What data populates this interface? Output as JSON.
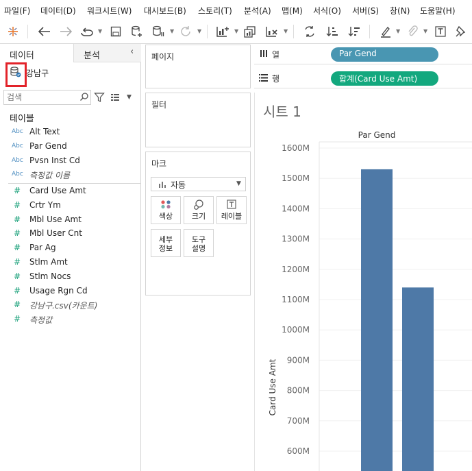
{
  "menu": [
    "파일(F)",
    "데이터(D)",
    "워크시트(W)",
    "대시보드(B)",
    "스토리(T)",
    "분석(A)",
    "맵(M)",
    "서식(O)",
    "서버(S)",
    "창(N)",
    "도움말(H)"
  ],
  "datapane": {
    "tab_data": "데이터",
    "tab_analysis": "분석",
    "datasource": "강남구",
    "search_placeholder": "검색",
    "tables_header": "테이블",
    "dimensions": [
      {
        "type": "Abc",
        "name": "Alt Text"
      },
      {
        "type": "Abc",
        "name": "Par Gend"
      },
      {
        "type": "Abc",
        "name": "Pvsn Inst Cd"
      },
      {
        "type": "Abc",
        "name": "측정값 이름"
      }
    ],
    "measures": [
      {
        "type": "#",
        "name": "Card Use Amt"
      },
      {
        "type": "#",
        "name": "Crtr Ym"
      },
      {
        "type": "#",
        "name": "Mbl Use Amt"
      },
      {
        "type": "#",
        "name": "Mbl User Cnt"
      },
      {
        "type": "#",
        "name": "Par Ag"
      },
      {
        "type": "#",
        "name": "Stlm Amt"
      },
      {
        "type": "#",
        "name": "Stlm Nocs"
      },
      {
        "type": "#",
        "name": "Usage Rgn Cd"
      },
      {
        "type": "#",
        "name": "강남구.csv(카운트)"
      },
      {
        "type": "#",
        "name": "측정값"
      }
    ]
  },
  "cards": {
    "pages": "페이지",
    "filters": "필터",
    "marks": "마크",
    "mark_type": "자동",
    "mark_buttons": [
      "색상",
      "크기",
      "레이블",
      "세부\n정보",
      "도구\n설명"
    ]
  },
  "shelves": {
    "columns_label": "열",
    "rows_label": "행",
    "columns_pill": "Par Gend",
    "rows_pill": "합계(Card Use Amt)",
    "columns_pill_color": "#4996b2",
    "rows_pill_color": "#13a87e"
  },
  "sheet_title": "시트 1",
  "chart_data": {
    "type": "bar",
    "title": "",
    "header": "Par Gend",
    "ylabel": "Card Use Amt",
    "yticks": [
      "1600M",
      "1500M",
      "1400M",
      "1300M",
      "1200M",
      "1100M",
      "1000M",
      "900M",
      "800M",
      "700M",
      "600M"
    ],
    "ylim_visible": [
      565,
      1620
    ],
    "categories": [
      "",
      ""
    ],
    "values": [
      1530,
      1140
    ],
    "bar_color": "#4e79a7"
  }
}
